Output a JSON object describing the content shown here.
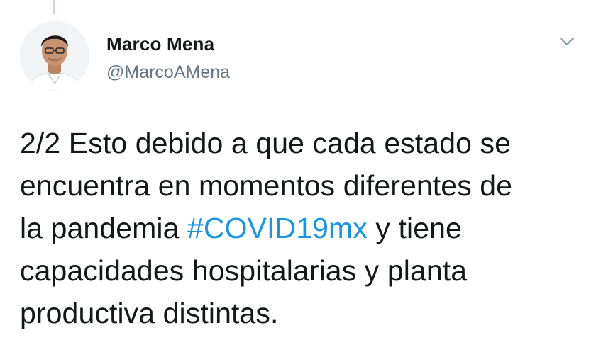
{
  "author": {
    "name": "Marco Mena",
    "handle": "@MarcoAMena",
    "avatar_icon": "profile-photo"
  },
  "menu": {
    "icon": "chevron-down-icon"
  },
  "tweet": {
    "line1": "2/2 Esto debido a que cada estado se",
    "line2": "encuentra en momentos diferentes de",
    "line3_before": "la pandemia ",
    "hashtag": "#COVID19mx",
    "line3_after": " y tiene",
    "line4": "capacidades hospitalarias y planta",
    "line5": "productiva distintas."
  },
  "colors": {
    "hashtag": "#1b95e0",
    "text": "#14171a",
    "secondary": "#657786",
    "thread_line": "#ccd6dd"
  }
}
